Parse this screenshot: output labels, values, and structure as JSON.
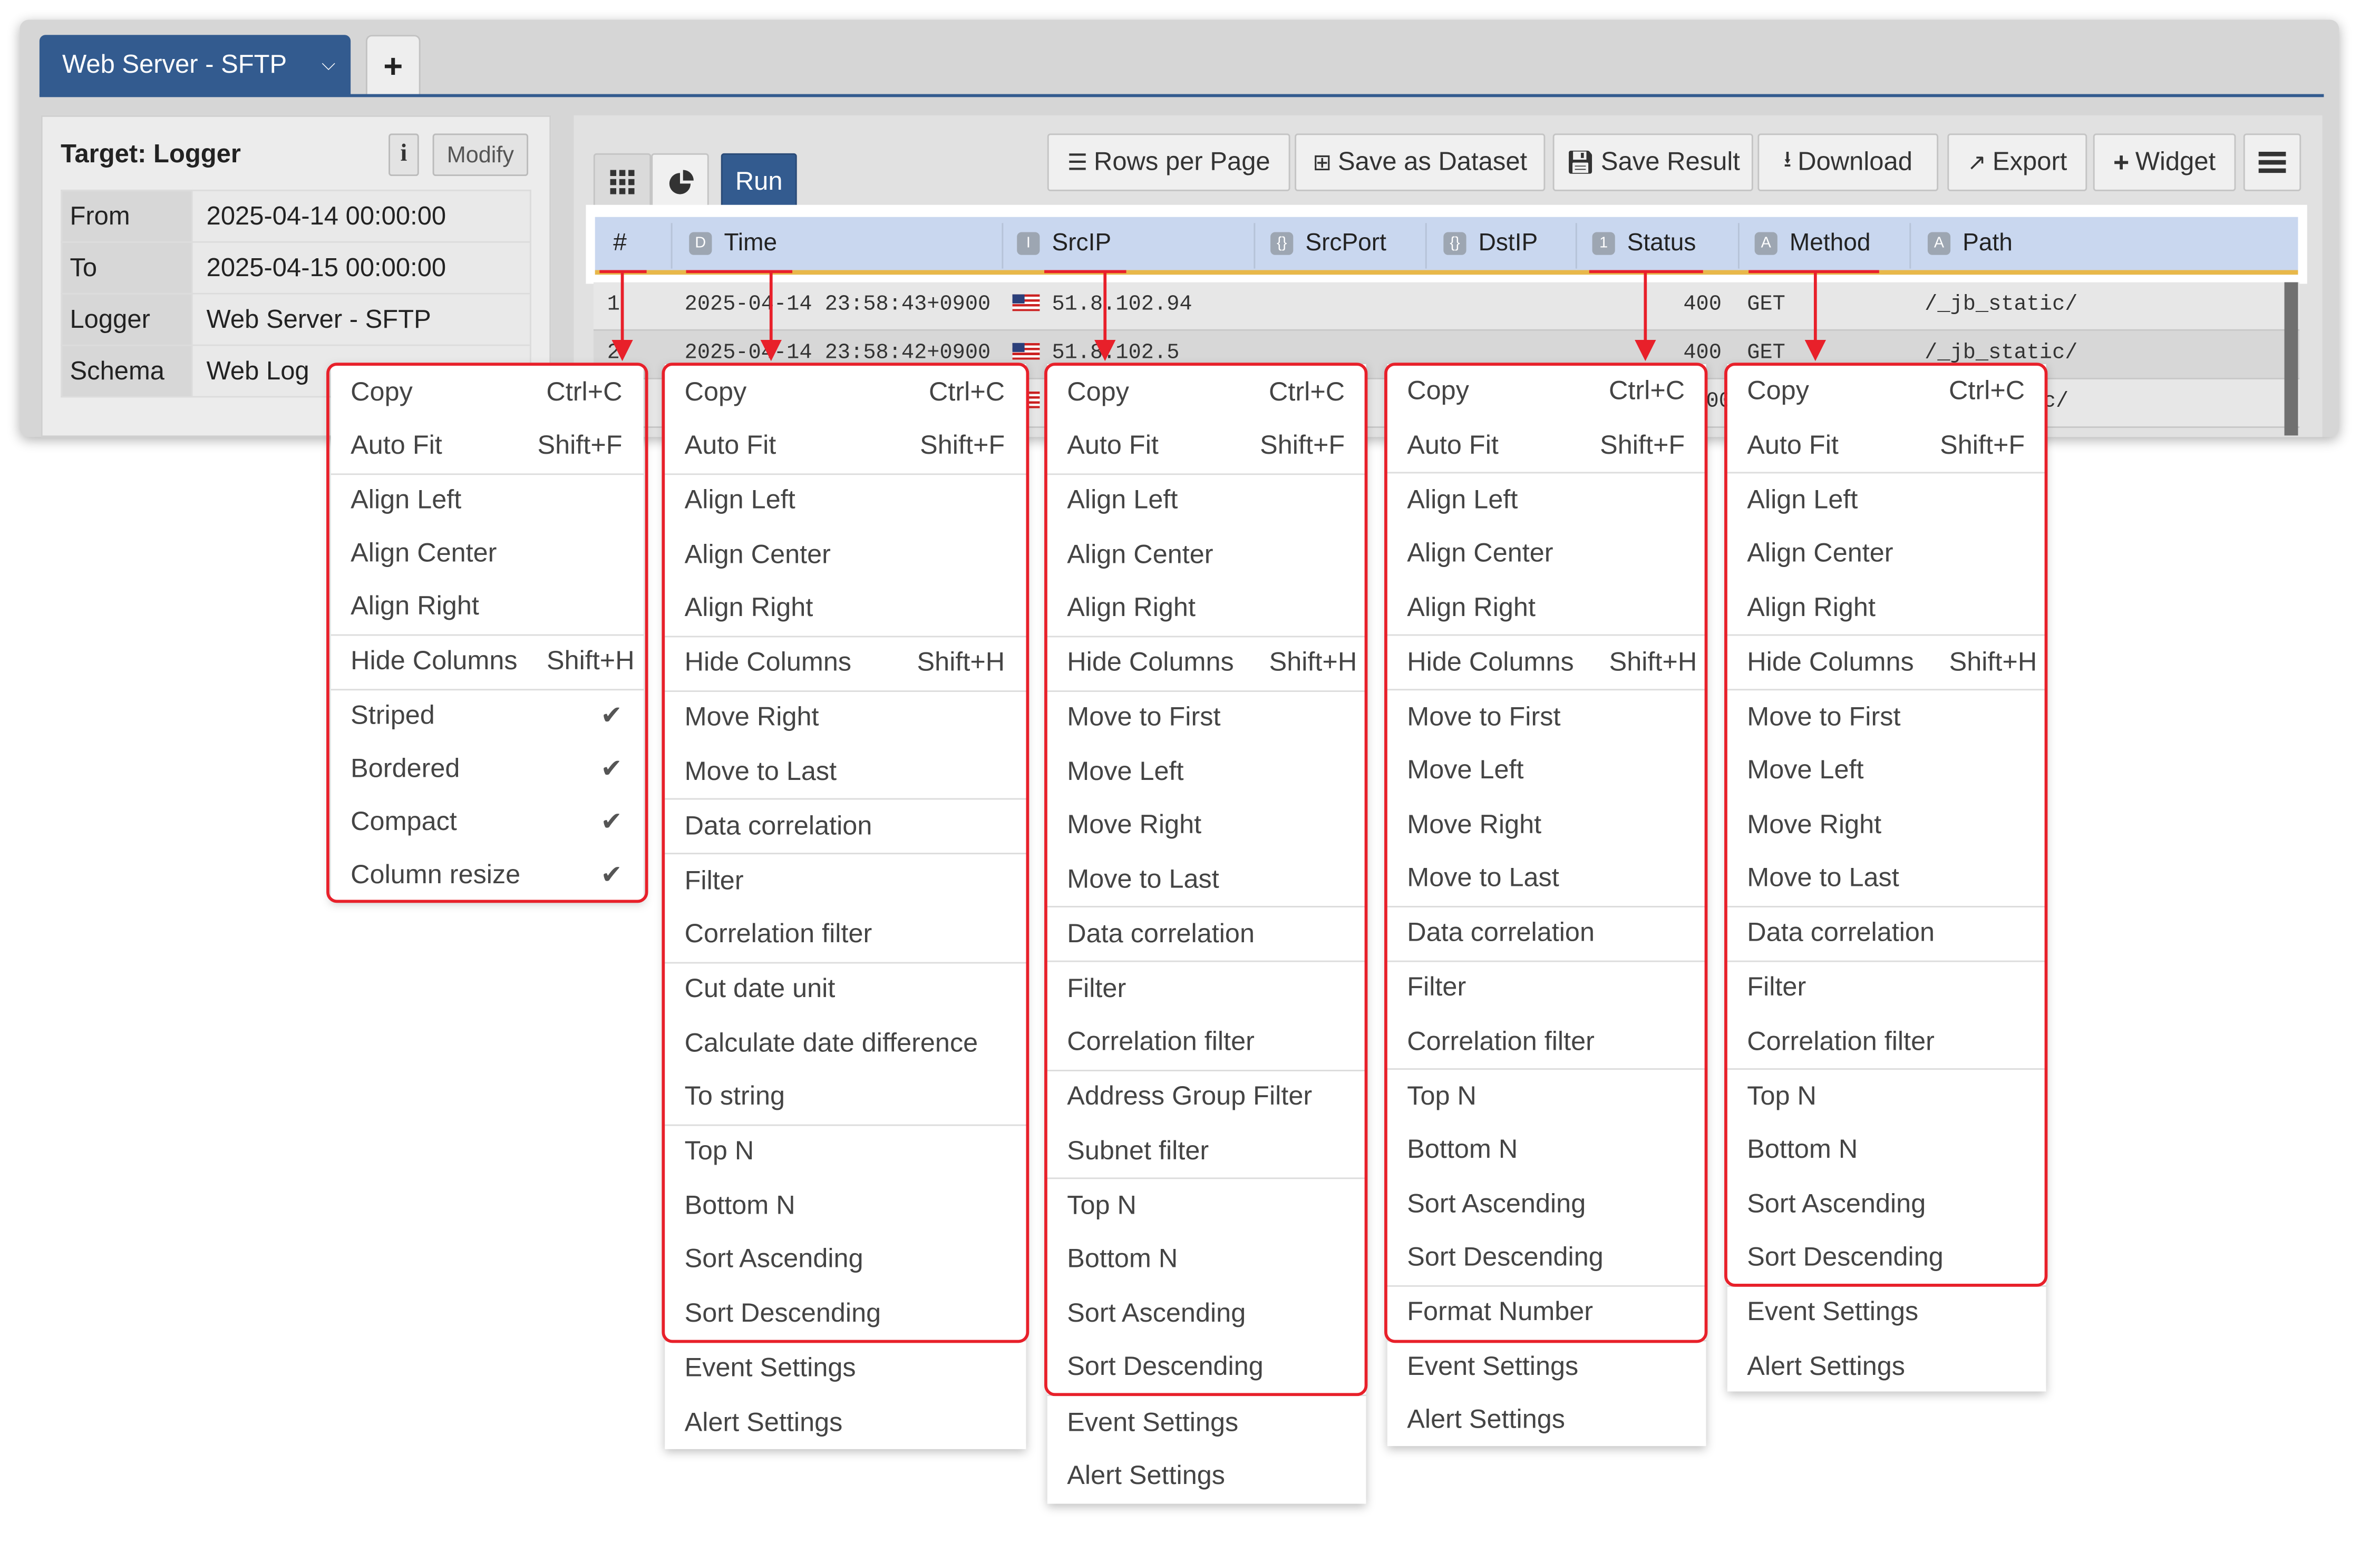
{
  "tabs": {
    "active": "Web Server - SFTP",
    "add_label": "+"
  },
  "target": {
    "title": "Target: Logger",
    "info_icon": "i",
    "modify_label": "Modify",
    "rows": [
      {
        "key": "From",
        "value": "2025-04-14 00:00:00"
      },
      {
        "key": "To",
        "value": "2025-04-15 00:00:00"
      },
      {
        "key": "Logger",
        "value": "Web Server - SFTP"
      },
      {
        "key": "Schema",
        "value": "Web Log"
      }
    ]
  },
  "toolbar": {
    "run_label": "Run",
    "rows_per_page": "Rows per Page",
    "save_dataset": "Save as Dataset",
    "save_result": "Save Result",
    "download": "Download",
    "export": "Export",
    "widget": "Widget"
  },
  "columns": [
    {
      "label": "#",
      "type_badge": ""
    },
    {
      "label": "Time",
      "type_badge": "D"
    },
    {
      "label": "SrcIP",
      "type_badge": "I"
    },
    {
      "label": "SrcPort",
      "type_badge": "{}"
    },
    {
      "label": "DstIP",
      "type_badge": "{}"
    },
    {
      "label": "Status",
      "type_badge": "1"
    },
    {
      "label": "Method",
      "type_badge": "A"
    },
    {
      "label": "Path",
      "type_badge": "A"
    }
  ],
  "rows": [
    {
      "num": "1",
      "time": "2025-04-14 23:58:43+0900",
      "srcip": "51.8.102.94",
      "status": "400",
      "method": "GET",
      "path": "/_jb_static/"
    },
    {
      "num": "2",
      "time": "2025-04-14 23:58:42+0900",
      "srcip": "51.8.102.5",
      "status": "400",
      "method": "GET",
      "path": "/_jb_static/"
    },
    {
      "num": "",
      "time": "",
      "srcip": "",
      "status": "00",
      "method": "",
      "path": "c/"
    }
  ],
  "shortcuts": {
    "copy": "Ctrl+C",
    "auto_fit": "Shift+F",
    "hide_columns": "Shift+H"
  },
  "menus": {
    "num_column": {
      "copy": "Copy",
      "auto_fit": "Auto Fit",
      "align_left": "Align Left",
      "align_center": "Align Center",
      "align_right": "Align Right",
      "hide_columns": "Hide Columns",
      "striped": "Striped",
      "bordered": "Bordered",
      "compact": "Compact",
      "column_resize": "Column resize"
    },
    "time_column": {
      "copy": "Copy",
      "auto_fit": "Auto Fit",
      "align_left": "Align Left",
      "align_center": "Align Center",
      "align_right": "Align Right",
      "hide_columns": "Hide Columns",
      "move_right": "Move Right",
      "move_to_last": "Move to Last",
      "data_correlation": "Data correlation",
      "filter": "Filter",
      "correlation_filter": "Correlation filter",
      "cut_date_unit": "Cut date unit",
      "calculate_date_difference": "Calculate date difference",
      "to_string": "To string",
      "top_n": "Top N",
      "bottom_n": "Bottom N",
      "sort_ascending": "Sort Ascending",
      "sort_descending": "Sort Descending",
      "event_settings": "Event Settings",
      "alert_settings": "Alert Settings"
    },
    "srcip_column": {
      "copy": "Copy",
      "auto_fit": "Auto Fit",
      "align_left": "Align Left",
      "align_center": "Align Center",
      "align_right": "Align Right",
      "hide_columns": "Hide Columns",
      "move_to_first": "Move to First",
      "move_left": "Move Left",
      "move_right": "Move Right",
      "move_to_last": "Move to Last",
      "data_correlation": "Data correlation",
      "filter": "Filter",
      "correlation_filter": "Correlation filter",
      "address_group_filter": "Address Group Filter",
      "subnet_filter": "Subnet filter",
      "top_n": "Top N",
      "bottom_n": "Bottom N",
      "sort_ascending": "Sort Ascending",
      "sort_descending": "Sort Descending",
      "event_settings": "Event Settings",
      "alert_settings": "Alert Settings"
    },
    "status_column": {
      "copy": "Copy",
      "auto_fit": "Auto Fit",
      "align_left": "Align Left",
      "align_center": "Align Center",
      "align_right": "Align Right",
      "hide_columns": "Hide Columns",
      "move_to_first": "Move to First",
      "move_left": "Move Left",
      "move_right": "Move Right",
      "move_to_last": "Move to Last",
      "data_correlation": "Data correlation",
      "filter": "Filter",
      "correlation_filter": "Correlation filter",
      "top_n": "Top N",
      "bottom_n": "Bottom N",
      "sort_ascending": "Sort Ascending",
      "sort_descending": "Sort Descending",
      "format_number": "Format Number",
      "event_settings": "Event Settings",
      "alert_settings": "Alert Settings"
    },
    "method_column": {
      "copy": "Copy",
      "auto_fit": "Auto Fit",
      "align_left": "Align Left",
      "align_center": "Align Center",
      "align_right": "Align Right",
      "hide_columns": "Hide Columns",
      "move_to_first": "Move to First",
      "move_left": "Move Left",
      "move_right": "Move Right",
      "move_to_last": "Move to Last",
      "data_correlation": "Data correlation",
      "filter": "Filter",
      "correlation_filter": "Correlation filter",
      "top_n": "Top N",
      "bottom_n": "Bottom N",
      "sort_ascending": "Sort Ascending",
      "sort_descending": "Sort Descending",
      "event_settings": "Event Settings",
      "alert_settings": "Alert Settings"
    }
  },
  "colors": {
    "accent": "#335b8f",
    "header_bg": "#c9d7ef",
    "highlight_red": "#e8202a",
    "sort_underline": "#e8b84a"
  }
}
